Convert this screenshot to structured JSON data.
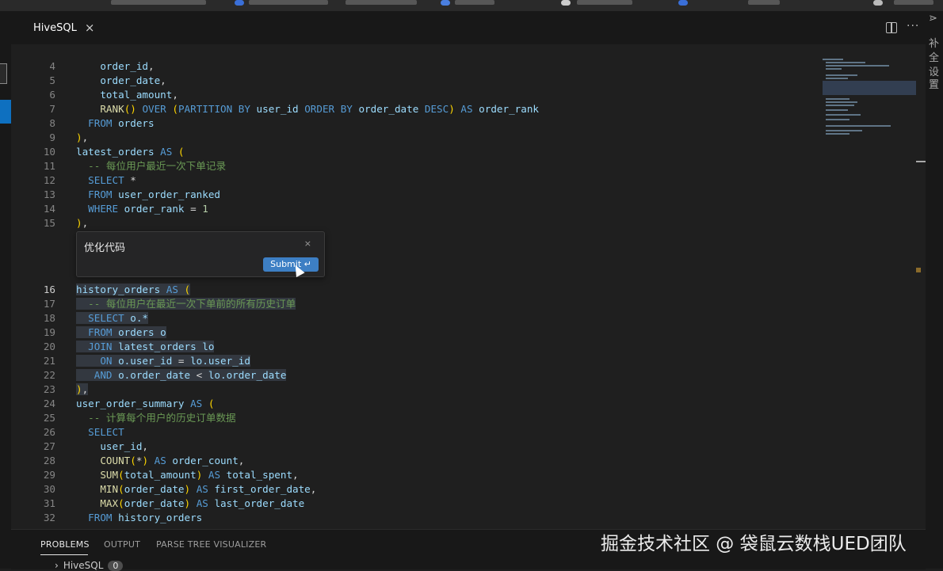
{
  "tab": {
    "title": "HiveSQL",
    "close": "×"
  },
  "toolbar": {
    "more": "···"
  },
  "right_panel": {
    "glyphs": [
      "⋗",
      "补",
      "全",
      "设",
      "置"
    ]
  },
  "code_lines": [
    {
      "num": "4",
      "tokens": [
        [
          "    ",
          ""
        ],
        [
          "order_id",
          "id"
        ],
        [
          ",",
          "pn"
        ]
      ]
    },
    {
      "num": "5",
      "tokens": [
        [
          "    ",
          ""
        ],
        [
          "order_date",
          "id"
        ],
        [
          ",",
          "pn"
        ]
      ]
    },
    {
      "num": "6",
      "tokens": [
        [
          "    ",
          ""
        ],
        [
          "total_amount",
          "id"
        ],
        [
          ",",
          "pn"
        ]
      ]
    },
    {
      "num": "7",
      "tokens": [
        [
          "    ",
          ""
        ],
        [
          "RANK",
          "fn"
        ],
        [
          "() ",
          "br"
        ],
        [
          "OVER",
          "kw"
        ],
        [
          " (",
          "br"
        ],
        [
          "PARTITION BY",
          "kw"
        ],
        [
          " user_id ",
          "id"
        ],
        [
          "ORDER BY",
          "kw"
        ],
        [
          " order_date ",
          "id"
        ],
        [
          "DESC",
          "kw"
        ],
        [
          ")",
          "br"
        ],
        [
          " AS ",
          "kw"
        ],
        [
          "order_rank",
          "id"
        ]
      ]
    },
    {
      "num": "8",
      "tokens": [
        [
          "  ",
          ""
        ],
        [
          "FROM",
          "kw"
        ],
        [
          " orders",
          "id"
        ]
      ]
    },
    {
      "num": "9",
      "tokens": [
        [
          ")",
          "br"
        ],
        [
          ",",
          "pn"
        ]
      ]
    },
    {
      "num": "10",
      "tokens": [
        [
          "latest_orders",
          "id"
        ],
        [
          " AS ",
          "kw"
        ],
        [
          "(",
          "br"
        ]
      ]
    },
    {
      "num": "11",
      "tokens": [
        [
          "  ",
          ""
        ],
        [
          "-- 每位用户最近一次下单记录",
          "cm"
        ]
      ]
    },
    {
      "num": "12",
      "tokens": [
        [
          "  ",
          ""
        ],
        [
          "SELECT",
          "kw"
        ],
        [
          " *",
          "op"
        ]
      ]
    },
    {
      "num": "13",
      "tokens": [
        [
          "  ",
          ""
        ],
        [
          "FROM",
          "kw"
        ],
        [
          " user_order_ranked",
          "id"
        ]
      ]
    },
    {
      "num": "14",
      "tokens": [
        [
          "  ",
          ""
        ],
        [
          "WHERE",
          "kw"
        ],
        [
          " order_rank ",
          "id"
        ],
        [
          "= ",
          "op"
        ],
        [
          "1",
          "num"
        ]
      ]
    },
    {
      "num": "15",
      "tokens": [
        [
          ")",
          "br"
        ],
        [
          ",",
          "pn"
        ]
      ]
    },
    {
      "num": "16",
      "tokens": [
        [
          "history_orders",
          "id"
        ],
        [
          " AS ",
          "kw"
        ],
        [
          "(",
          "br"
        ]
      ],
      "hl": true,
      "active": true
    },
    {
      "num": "17",
      "tokens": [
        [
          "  ",
          ""
        ],
        [
          "-- 每位用户在最近一次下单前的所有历史订单",
          "cm"
        ]
      ],
      "hl": true
    },
    {
      "num": "18",
      "tokens": [
        [
          "  ",
          ""
        ],
        [
          "SELECT",
          "kw"
        ],
        [
          " o.*",
          "id"
        ]
      ],
      "hl": true
    },
    {
      "num": "19",
      "tokens": [
        [
          "  ",
          ""
        ],
        [
          "FROM",
          "kw"
        ],
        [
          " orders o",
          "id"
        ]
      ],
      "hl": true
    },
    {
      "num": "20",
      "tokens": [
        [
          "  ",
          ""
        ],
        [
          "JOIN",
          "kw"
        ],
        [
          " latest_orders lo",
          "id"
        ]
      ],
      "hl": true
    },
    {
      "num": "21",
      "tokens": [
        [
          "    ",
          ""
        ],
        [
          "ON",
          "kw"
        ],
        [
          " o.user_id ",
          "id"
        ],
        [
          "= ",
          "op"
        ],
        [
          "lo.user_id",
          "id"
        ]
      ],
      "hl": true
    },
    {
      "num": "22",
      "tokens": [
        [
          "   ",
          ""
        ],
        [
          "AND",
          "kw"
        ],
        [
          " o.order_date ",
          "id"
        ],
        [
          "< ",
          "op"
        ],
        [
          "lo.order_date",
          "id"
        ]
      ],
      "hl": true
    },
    {
      "num": "23",
      "tokens": [
        [
          ")",
          "br"
        ],
        [
          ",",
          "pn"
        ]
      ],
      "hl": true
    },
    {
      "num": "24",
      "tokens": [
        [
          "user_order_summary",
          "id"
        ],
        [
          " AS ",
          "kw"
        ],
        [
          "(",
          "br"
        ]
      ]
    },
    {
      "num": "25",
      "tokens": [
        [
          "  ",
          ""
        ],
        [
          "-- 计算每个用户的历史订单数据",
          "cm"
        ]
      ]
    },
    {
      "num": "26",
      "tokens": [
        [
          "  ",
          ""
        ],
        [
          "SELECT",
          "kw"
        ]
      ]
    },
    {
      "num": "27",
      "tokens": [
        [
          "    ",
          ""
        ],
        [
          "user_id",
          "id"
        ],
        [
          ",",
          "pn"
        ]
      ]
    },
    {
      "num": "28",
      "tokens": [
        [
          "    ",
          ""
        ],
        [
          "COUNT",
          "fn"
        ],
        [
          "(",
          "br"
        ],
        [
          "*",
          "op"
        ],
        [
          ")",
          "br"
        ],
        [
          " AS ",
          "kw"
        ],
        [
          "order_count",
          "id"
        ],
        [
          ",",
          "pn"
        ]
      ]
    },
    {
      "num": "29",
      "tokens": [
        [
          "    ",
          ""
        ],
        [
          "SUM",
          "fn"
        ],
        [
          "(",
          "br"
        ],
        [
          "total_amount",
          "id"
        ],
        [
          ")",
          "br"
        ],
        [
          " AS ",
          "kw"
        ],
        [
          "total_spent",
          "id"
        ],
        [
          ",",
          "pn"
        ]
      ]
    },
    {
      "num": "30",
      "tokens": [
        [
          "    ",
          ""
        ],
        [
          "MIN",
          "fn"
        ],
        [
          "(",
          "br"
        ],
        [
          "order_date",
          "id"
        ],
        [
          ")",
          "br"
        ],
        [
          " AS ",
          "kw"
        ],
        [
          "first_order_date",
          "id"
        ],
        [
          ",",
          "pn"
        ]
      ]
    },
    {
      "num": "31",
      "tokens": [
        [
          "    ",
          ""
        ],
        [
          "MAX",
          "fn"
        ],
        [
          "(",
          "br"
        ],
        [
          "order_date",
          "id"
        ],
        [
          ")",
          "br"
        ],
        [
          " AS ",
          "kw"
        ],
        [
          "last_order_date",
          "id"
        ]
      ]
    },
    {
      "num": "32",
      "tokens": [
        [
          "  ",
          ""
        ],
        [
          "FROM",
          "kw"
        ],
        [
          " history_orders",
          "id"
        ]
      ]
    }
  ],
  "chat": {
    "input_text": "优化代码",
    "close": "×",
    "submit_label": "Submit ↵"
  },
  "panel": {
    "tabs": [
      "PROBLEMS",
      "OUTPUT",
      "PARSE TREE VISUALIZER"
    ],
    "active_tab": "PROBLEMS",
    "tree_item": {
      "chevron": "›",
      "label": "HiveSQL",
      "count": "0"
    }
  },
  "watermark": "掘金技术社区 @ 袋鼠云数栈UED团队",
  "colors": {
    "background": "#1f1f1f",
    "keyword": "#569cd6",
    "identifier": "#9cdcfe",
    "function": "#dcdcaa",
    "comment": "#6a9955",
    "accent": "#3d7fc4"
  }
}
